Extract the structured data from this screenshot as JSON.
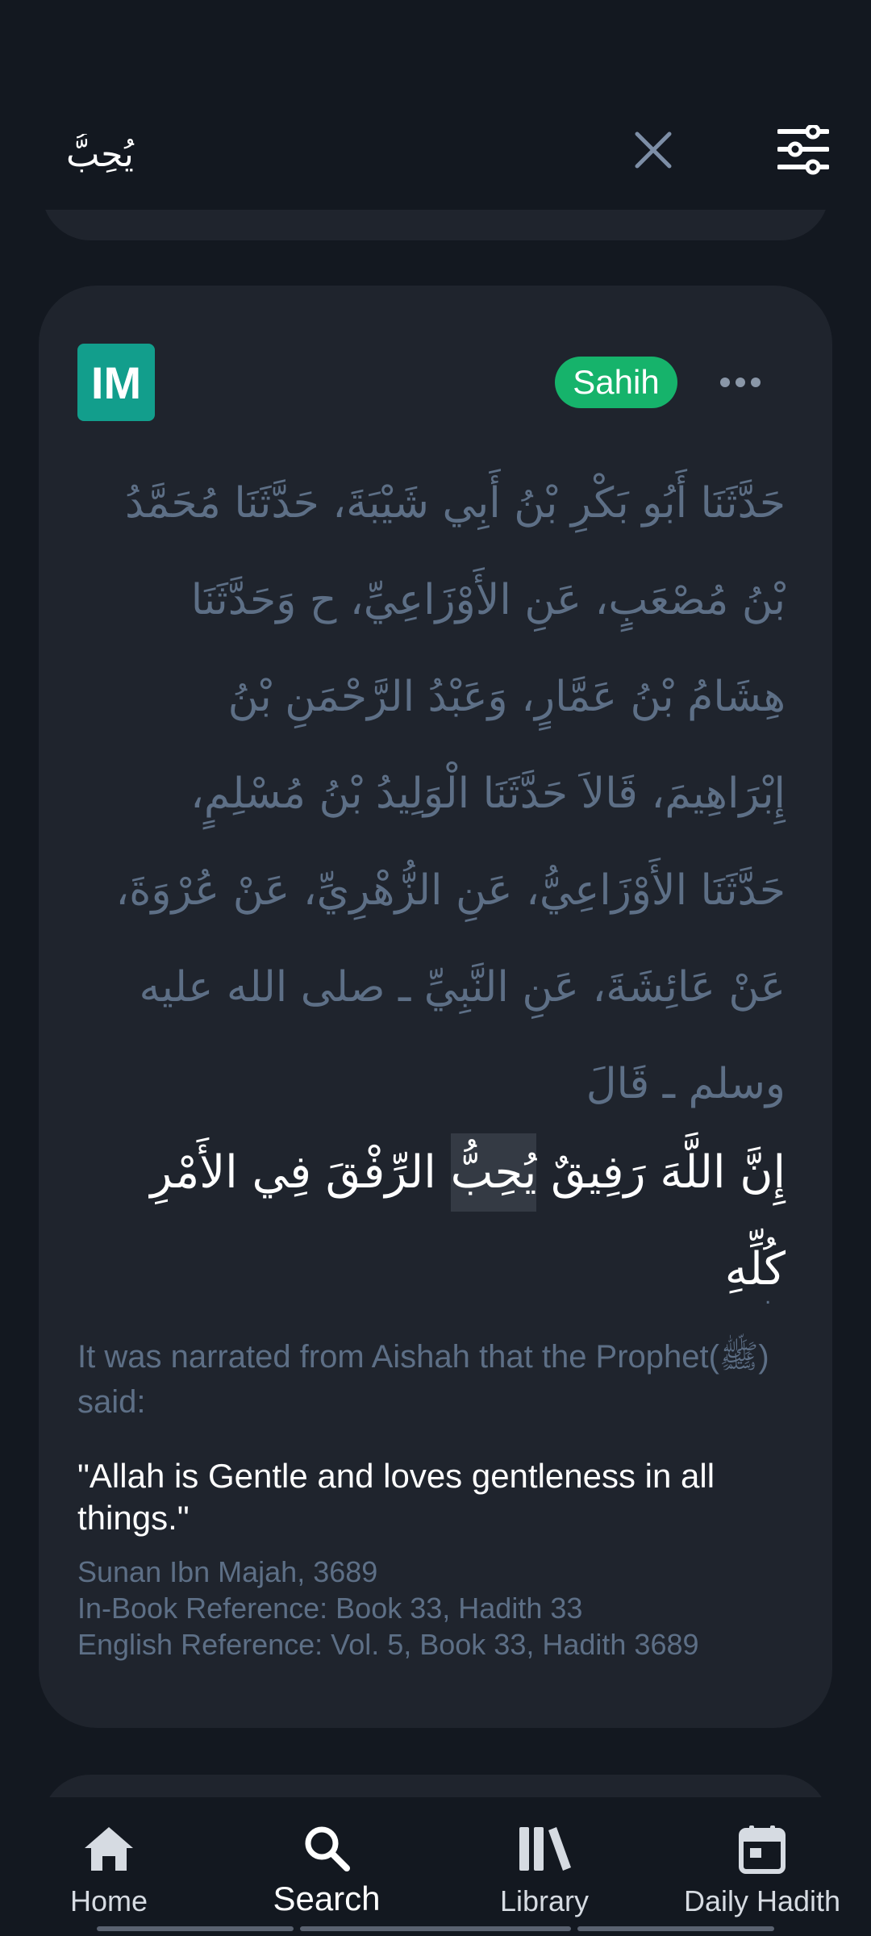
{
  "search": {
    "query": "يُحِبُّ",
    "clear_icon": "close-icon",
    "filter_icon": "sliders-icon"
  },
  "hadith": {
    "book_abbr": "IM",
    "grade": "Sahih",
    "more_icon": "more-horizontal-icon",
    "arabic_isnad": "حَدَّثَنَا أَبُو بَكْرِ بْنُ أَبِي شَيْبَةَ، حَدَّثَنَا مُحَمَّدُ بْنُ مُصْعَبٍ، عَنِ الأَوْزَاعِيِّ، ح وَحَدَّثَنَا هِشَامُ بْنُ عَمَّارٍ، وَعَبْدُ الرَّحْمَنِ بْنُ إِبْرَاهِيمَ، قَالاَ حَدَّثَنَا الْوَلِيدُ بْنُ مُسْلِمٍ، حَدَّثَنَا الأَوْزَاعِيُّ، عَنِ الزُّهْرِيِّ، عَنْ عُرْوَةَ، عَنْ عَائِشَةَ، عَنِ النَّبِيِّ ـ صلى الله عليه وسلم ـ قَالَ",
    "arabic_matn_before": "إِنَّ اللَّهَ رَفِيقٌ ",
    "arabic_matn_highlight": "يُحِبُّ",
    "arabic_matn_after": " الرِّفْقَ فِي الأَمْرِ كُلِّهِ",
    "arabic_end": ".",
    "narrator": "It was narrated from Aishah that the Prophet(ﷺ) said:",
    "text_en": "\"Allah is Gentle and loves gentleness in all things.\"",
    "reference": "Sunan Ibn Majah, 3689",
    "in_book_reference": "In-Book Reference: Book 33, Hadith 33",
    "english_reference": "English Reference: Vol. 5, Book 33, Hadith 3689"
  },
  "nav": {
    "home": "Home",
    "search": "Search",
    "library": "Library",
    "daily": "Daily Hadith",
    "active": "search"
  },
  "colors": {
    "background": "#131820",
    "card": "#1f242d",
    "muted_text": "#5d6f86",
    "book_badge": "#129e8c",
    "grade_badge": "#16b36b"
  }
}
